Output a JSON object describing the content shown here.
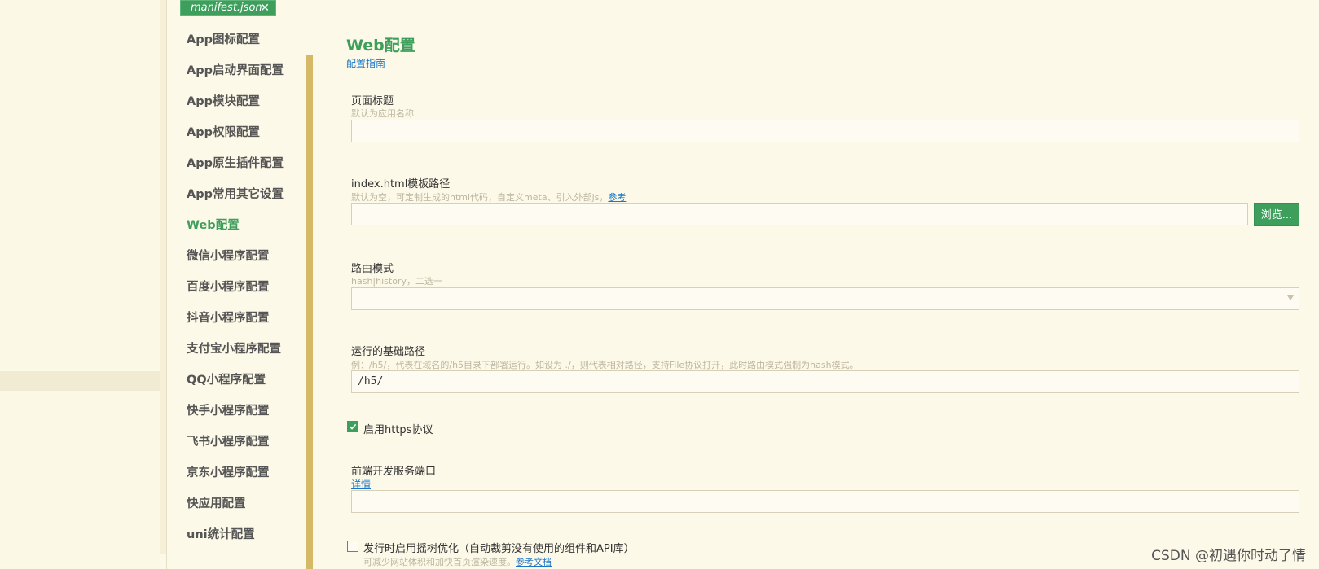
{
  "tab": {
    "label": "manifest.json",
    "close": "✕"
  },
  "nav": {
    "items": [
      {
        "label": "App图标配置"
      },
      {
        "label": "App启动界面配置"
      },
      {
        "label": "App模块配置"
      },
      {
        "label": "App权限配置"
      },
      {
        "label": "App原生插件配置"
      },
      {
        "label": "App常用其它设置"
      },
      {
        "label": "Web配置"
      },
      {
        "label": "微信小程序配置"
      },
      {
        "label": "百度小程序配置"
      },
      {
        "label": "抖音小程序配置"
      },
      {
        "label": "支付宝小程序配置"
      },
      {
        "label": "QQ小程序配置"
      },
      {
        "label": "快手小程序配置"
      },
      {
        "label": "飞书小程序配置"
      },
      {
        "label": "京东小程序配置"
      },
      {
        "label": "快应用配置"
      },
      {
        "label": "uni统计配置"
      }
    ],
    "active": "Web配置"
  },
  "main": {
    "title": "Web配置",
    "guide_link": "配置指南",
    "page_title": {
      "label": "页面标题",
      "hint": "默认为应用名称",
      "value": ""
    },
    "template": {
      "label": "index.html模板路径",
      "hint": "默认为空，可定制生成的html代码，自定义meta、引入外部js，",
      "hint_link": "参考",
      "value": "",
      "browse": "浏览..."
    },
    "router": {
      "label": "路由模式",
      "hint": "hash|history，二选一",
      "value": ""
    },
    "base_path": {
      "label": "运行的基础路径",
      "hint": "例：/h5/，代表在域名的/h5目录下部署运行。如设为 ./，则代表相对路径，支持File协议打开，此时路由模式强制为hash模式。",
      "value": "/h5/"
    },
    "https": {
      "label": "启用https协议",
      "checked": true
    },
    "port": {
      "label": "前端开发服务端口",
      "link": "详情",
      "value": ""
    },
    "treeshake": {
      "label": "发行时启用摇树优化（自动裁剪没有使用的组件和API库）",
      "hint": "可减少网站体积和加快首页渲染速度。",
      "hint_link": "参考文档",
      "checked": false
    }
  },
  "watermark": "CSDN @初遇你时动了情",
  "colors": {
    "accent": "#3d9f5b",
    "link": "#1a77c9",
    "scrollbar": "#d6b967",
    "background": "#fdf9e8"
  }
}
